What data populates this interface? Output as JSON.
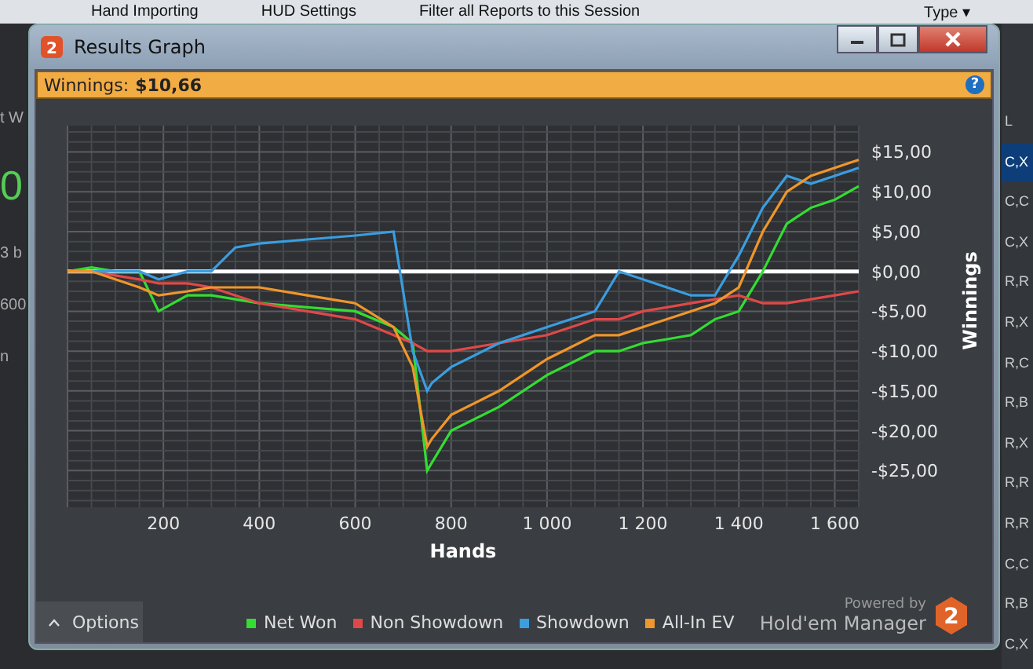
{
  "background_app": {
    "toolbar": [
      "Hand Importing",
      "HUD Settings",
      "Filter all Reports to this Session",
      "Type ▾"
    ],
    "left_fragments": [
      "t W",
      "0",
      "3 b",
      "600",
      "n"
    ],
    "right_column": {
      "header": "L",
      "rows": [
        {
          "text": "C,X",
          "selected": true
        },
        {
          "text": "C,C",
          "selected": false
        },
        {
          "text": "C,X",
          "selected": false
        },
        {
          "text": "R,R",
          "selected": false
        },
        {
          "text": "R,X",
          "selected": false
        },
        {
          "text": "R,C",
          "selected": false
        },
        {
          "text": "R,B",
          "selected": false
        },
        {
          "text": "R,X",
          "selected": false
        },
        {
          "text": "R,R",
          "selected": false
        },
        {
          "text": "R,R",
          "selected": false
        },
        {
          "text": "C,C",
          "selected": false
        },
        {
          "text": "R,B",
          "selected": false
        },
        {
          "text": "C,X",
          "selected": false
        }
      ]
    }
  },
  "window": {
    "title": "Results Graph",
    "logo": "2"
  },
  "info_bar": {
    "label": "Winnings:",
    "value": "$10,66",
    "help": "?"
  },
  "chart_data": {
    "type": "line",
    "grid": true,
    "xlabel": "Hands",
    "ylabel": "Winnings",
    "x": [
      0,
      50,
      100,
      150,
      190,
      250,
      300,
      350,
      400,
      500,
      600,
      680,
      720,
      750,
      760,
      800,
      900,
      1000,
      1100,
      1150,
      1200,
      1250,
      1300,
      1350,
      1400,
      1450,
      1500,
      1550,
      1600,
      1650
    ],
    "series": [
      {
        "name": "Net Won",
        "color": "#33dd33",
        "values": [
          0,
          0.5,
          0,
          0,
          -5,
          -3,
          -3,
          -3.5,
          -4,
          -4.5,
          -5,
          -7,
          -9,
          -25,
          -24,
          -20,
          -17,
          -13,
          -10,
          -10,
          -9,
          -8.5,
          -8,
          -6,
          -5,
          0,
          6,
          8,
          9,
          10.7
        ]
      },
      {
        "name": "Non Showdown",
        "color": "#e04848",
        "values": [
          0,
          0,
          -0.5,
          -1,
          -1.5,
          -1.5,
          -2,
          -3,
          -4,
          -5,
          -6,
          -8,
          -9,
          -10,
          -10,
          -10,
          -9,
          -8,
          -6,
          -6,
          -5,
          -4.5,
          -4,
          -3.5,
          -3,
          -4,
          -4,
          -3.5,
          -3,
          -2.5
        ]
      },
      {
        "name": "Showdown",
        "color": "#3a9ee0",
        "values": [
          0,
          0,
          0,
          0,
          -1,
          0,
          0,
          3,
          3.5,
          4,
          4.5,
          5,
          -10,
          -15,
          -14,
          -12,
          -9,
          -7,
          -5,
          0,
          -1,
          -2,
          -3,
          -3,
          2,
          8,
          12,
          11,
          12,
          13
        ]
      },
      {
        "name": "All-In EV",
        "color": "#f0962a",
        "values": [
          0,
          0,
          -1,
          -2,
          -3,
          -2.5,
          -2,
          -2,
          -2,
          -3,
          -4,
          -7,
          -12,
          -22,
          -21,
          -18,
          -15,
          -11,
          -8,
          -8,
          -7,
          -6,
          -5,
          -4,
          -2,
          5,
          10,
          12,
          13,
          14
        ]
      }
    ],
    "xlim": [
      0,
      1650
    ],
    "ylim": [
      -29.6,
      18.3
    ],
    "xticks": [
      {
        "value": 200,
        "label": "200"
      },
      {
        "value": 400,
        "label": "400"
      },
      {
        "value": 600,
        "label": "600"
      },
      {
        "value": 800,
        "label": "800"
      },
      {
        "value": 1000,
        "label": "1 000"
      },
      {
        "value": 1200,
        "label": "1 200"
      },
      {
        "value": 1400,
        "label": "1 400"
      },
      {
        "value": 1600,
        "label": "1 600"
      }
    ],
    "yticks": [
      {
        "value": 15,
        "label": "$15,00"
      },
      {
        "value": 10,
        "label": "$10,00"
      },
      {
        "value": 5,
        "label": "$5,00"
      },
      {
        "value": 0,
        "label": "$0,00"
      },
      {
        "value": -5,
        "label": "-$5,00"
      },
      {
        "value": -10,
        "label": "-$10,00"
      },
      {
        "value": -15,
        "label": "-$15,00"
      },
      {
        "value": -20,
        "label": "-$20,00"
      },
      {
        "value": -25,
        "label": "-$25,00"
      }
    ]
  },
  "options_button": "Options",
  "branding": {
    "powered_by": "Powered by",
    "product": "Hold'em Manager",
    "logo": "2"
  }
}
